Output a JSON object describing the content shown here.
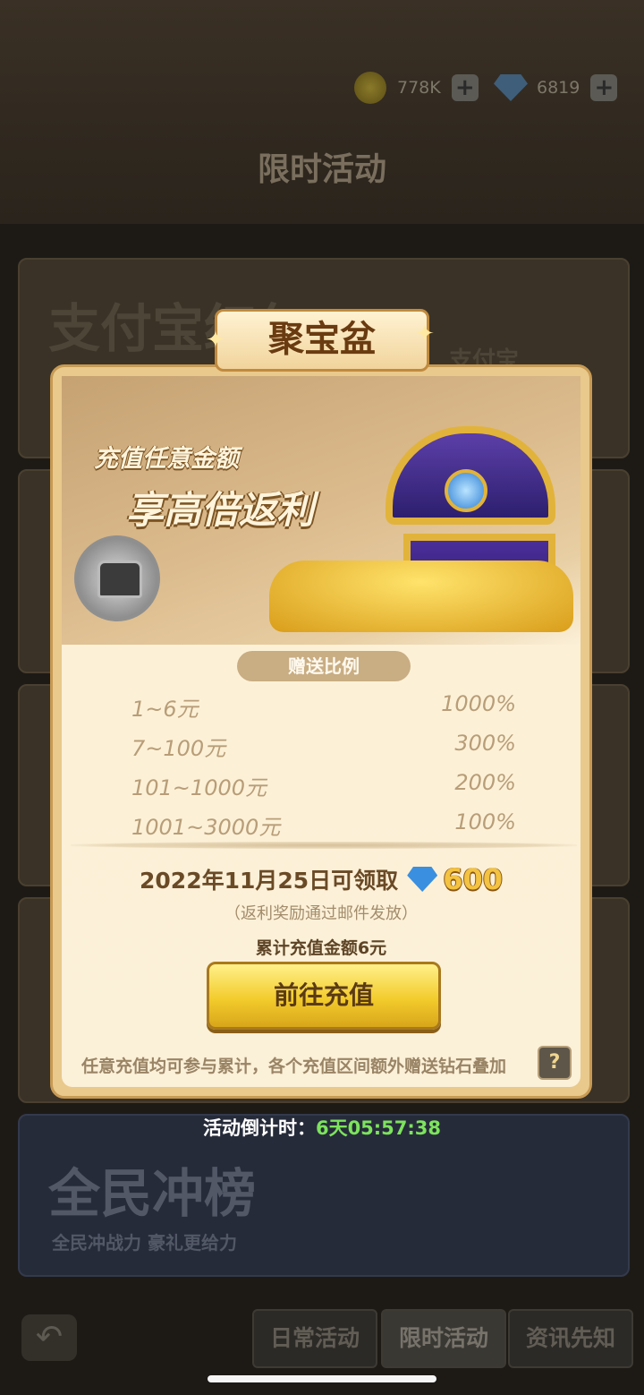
{
  "resources": {
    "coins": "778K",
    "gems": "6819"
  },
  "header": {
    "title": "限时活动"
  },
  "bg_cards": {
    "alipay_title": "支付宝红包",
    "alipay_brand": "支付宝",
    "ranking_title": "全民冲榜",
    "ranking_subtitle": "全民冲战力 豪礼更给力"
  },
  "popup": {
    "title": "聚宝盆",
    "banner_line1": "充值任意金额",
    "banner_line2": "享高倍返利",
    "section_label": "赠送比例",
    "rates": [
      {
        "range": "1~6元",
        "ratio": "1000%"
      },
      {
        "range": "7~100元",
        "ratio": "300%"
      },
      {
        "range": "101~1000元",
        "ratio": "200%"
      },
      {
        "range": "1001~3000元",
        "ratio": "100%"
      }
    ],
    "claim_text": "2022年11月25日可领取",
    "claim_amount": "600",
    "note": "（返利奖励通过邮件发放）",
    "total_text": "累计充值金额6元",
    "button_label": "前往充值",
    "tip": "任意充值均可参与累计，各个充值区间额外赠送钻石叠加",
    "help_label": "?"
  },
  "countdown": {
    "label": "活动倒计时：",
    "value": "6天05:57:38"
  },
  "tabs": [
    {
      "label": "日常活动"
    },
    {
      "label": "限时活动"
    },
    {
      "label": "资讯先知"
    }
  ]
}
